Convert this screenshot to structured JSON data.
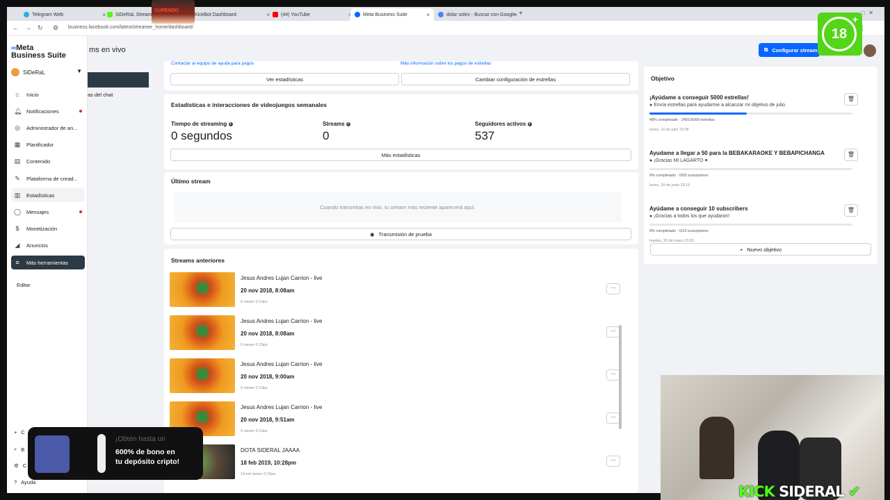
{
  "browser": {
    "tabs": [
      {
        "label": "Telegram Web",
        "favicon": "#2aabee"
      },
      {
        "label": "SiDeRaL Stream - W",
        "favicon": "#53fc18"
      },
      {
        "label": "KickBot Dashboard",
        "favicon": ""
      },
      {
        "label": "(44) YouTube",
        "favicon": "#ff0000"
      },
      {
        "label": "Meta Business Suite",
        "favicon": "#0866ff"
      },
      {
        "label": "dolar soles - Buscar con Google",
        "favicon": "#4285f4"
      }
    ],
    "url": "business.facebook.com/latest/streamer_home/dashboard/"
  },
  "sidebar": {
    "logo_line1": "Meta",
    "logo_line2": "Business Suite",
    "account": "SiDeRaL",
    "items": [
      {
        "label": "Inicio",
        "icon": "home-icon"
      },
      {
        "label": "Notificaciones",
        "icon": "bell-icon",
        "dot": true
      },
      {
        "label": "Administrador de an...",
        "icon": "target-icon"
      },
      {
        "label": "Planificador",
        "icon": "calendar-icon"
      },
      {
        "label": "Contenido",
        "icon": "content-icon"
      },
      {
        "label": "Plataforma de cread...",
        "icon": "creator-icon"
      },
      {
        "label": "Estadísticas",
        "icon": "stats-icon"
      },
      {
        "label": "Mensajes",
        "icon": "chat-icon",
        "dot": true
      },
      {
        "label": "Monetización",
        "icon": "money-icon"
      },
      {
        "label": "Anuncios",
        "icon": "megaphone-icon"
      },
      {
        "label": "Más herramientas",
        "icon": "menu-icon"
      }
    ],
    "edit": "Editar",
    "help": "Ayuda",
    "bottom_fragments": [
      "C",
      "B",
      "C"
    ]
  },
  "ad": {
    "line1": "¡Obtén hasta un",
    "line2": "600% de bono en",
    "line3": "tu depósito cripto!"
  },
  "header": {
    "title_fragment": "ms en vivo",
    "chat_fragment": "as del chat",
    "configure_button": "Configurar stream"
  },
  "stars": {
    "link_left": "Contactar al equipo de ayuda para pagos",
    "link_right": "Más información sobre los pagos de estrellas",
    "view_stats": "Ver estadísticas",
    "change_config": "Cambiar configuración de estrellas"
  },
  "weekly": {
    "title": "Estadísticas e interacciones de videojuegos semanales",
    "streaming_time_label": "Tiempo de streaming",
    "streaming_time_value": "0 segundos",
    "streams_label": "Streams",
    "streams_value": "0",
    "followers_label": "Seguidores activos",
    "followers_value": "537",
    "more_stats": "Más estadísticas"
  },
  "last_stream": {
    "title": "Último stream",
    "empty": "Cuando transmitas en vivo, tu stream más reciente aparecerá aquí.",
    "test_button": "Transmisión de prueba"
  },
  "previous": {
    "title": "Streams anteriores",
    "items": [
      {
        "title": "Jesus Andres Lujan Carrion - live",
        "date": "20 nov 2018, 8:08am",
        "meta": "0 views• 0 Clips"
      },
      {
        "title": "Jesus Andres Lujan Carrion - live",
        "date": "20 nov 2018, 8:08am",
        "meta": "0 views• 0 Clips"
      },
      {
        "title": "Jesus Andres Lujan Carrion - live",
        "date": "20 nov 2018, 9:00am",
        "meta": "0 views• 0 Clips"
      },
      {
        "title": "Jesus Andres Lujan Carrion - live",
        "date": "20 nov 2018, 9:51am",
        "meta": "0 views• 0 Clips"
      },
      {
        "title": "DOTA SIDERAL JAAAA",
        "date": "18 feb 2019, 10:28pm",
        "meta": "14 mil views• 0 Clips"
      }
    ],
    "more_glyph": "···"
  },
  "goals": {
    "title": "Objetivo",
    "items": [
      {
        "title": "¡Ayúdame a conseguir 5000 estrellas!",
        "sub": "Envía estrellas para ayudarme a alcanzar mi objetivo de julio.",
        "progress": "48% completado  ·  2401/5000 estrellas",
        "fill": 0.48,
        "date": "lunes, 10 de julio 19:38"
      },
      {
        "title": "Ayudame a llegar a 50 para la BEBAKARAOKE Y BEBAPICHANGA",
        "sub": "¡Gracias MI LAGARTO ♥",
        "progress": "0% completado  ·  0/50 suscriptores",
        "fill": 0,
        "date": "lunes, 19 de junio 23:15"
      },
      {
        "title": "Ayúdame a conseguir 10 subscribers",
        "sub": "¡Gracias a todos los que ayudaron!",
        "progress": "0% completado  ·  0/10 suscriptores",
        "fill": 0,
        "date": "martes, 30 de mayo 23:03"
      }
    ],
    "new_goal": "Nuevo objetivo"
  },
  "overlay": {
    "kick_brand": "KICK",
    "kick_name": "SIDERAL",
    "age_badge": "18",
    "age_plus": "+",
    "sticker_text": "CUPENDO"
  },
  "colors": {
    "accent": "#0866ff",
    "kick_green": "#53fc18",
    "nav_active": "#2c3a45"
  }
}
